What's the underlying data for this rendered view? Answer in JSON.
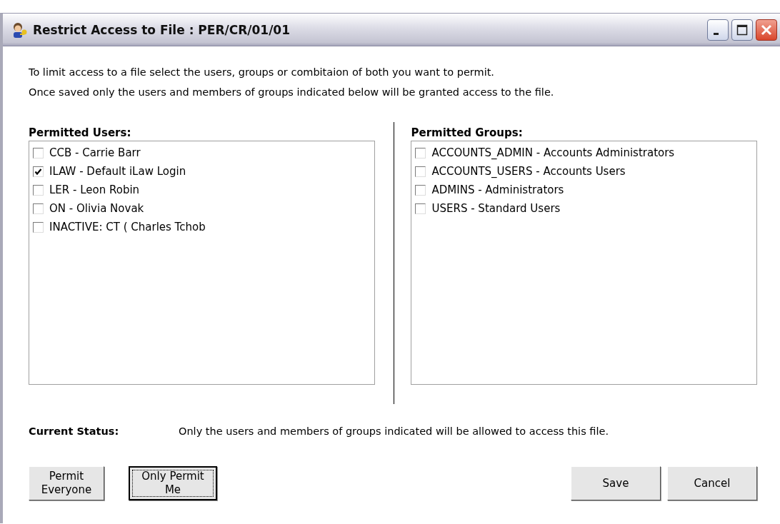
{
  "window": {
    "title": "Restrict Access to File : PER/CR/01/01"
  },
  "intro": [
    "To limit access to a file select the users, groups or combitaion of both you want to permit.",
    "Once saved only the users and members of groups indicated below will be granted access to the file."
  ],
  "users": {
    "heading": "Permitted Users:",
    "items": [
      {
        "label": "CCB - Carrie Barr",
        "checked": false
      },
      {
        "label": "ILAW - Default iLaw Login",
        "checked": true
      },
      {
        "label": "LER - Leon Robin",
        "checked": false
      },
      {
        "label": "ON - Olivia Novak",
        "checked": false
      },
      {
        "label": "INACTIVE: CT ( Charles Tchob",
        "checked": false
      }
    ]
  },
  "groups": {
    "heading": "Permitted Groups:",
    "items": [
      {
        "label": "ACCOUNTS_ADMIN - Accounts Administrators",
        "checked": false
      },
      {
        "label": "ACCOUNTS_USERS - Accounts Users",
        "checked": false
      },
      {
        "label": "ADMINS - Administrators",
        "checked": false
      },
      {
        "label": "USERS - Standard Users",
        "checked": false
      }
    ]
  },
  "status": {
    "label": "Current Status:",
    "value": "Only the users and members of groups indicated will be allowed to access this file."
  },
  "buttons": [
    {
      "label": "Permit Everyone",
      "focused": false
    },
    {
      "label": "Only Permit Me",
      "focused": true
    },
    {
      "label": "Save",
      "focused": false
    },
    {
      "label": "Cancel",
      "focused": false
    }
  ]
}
